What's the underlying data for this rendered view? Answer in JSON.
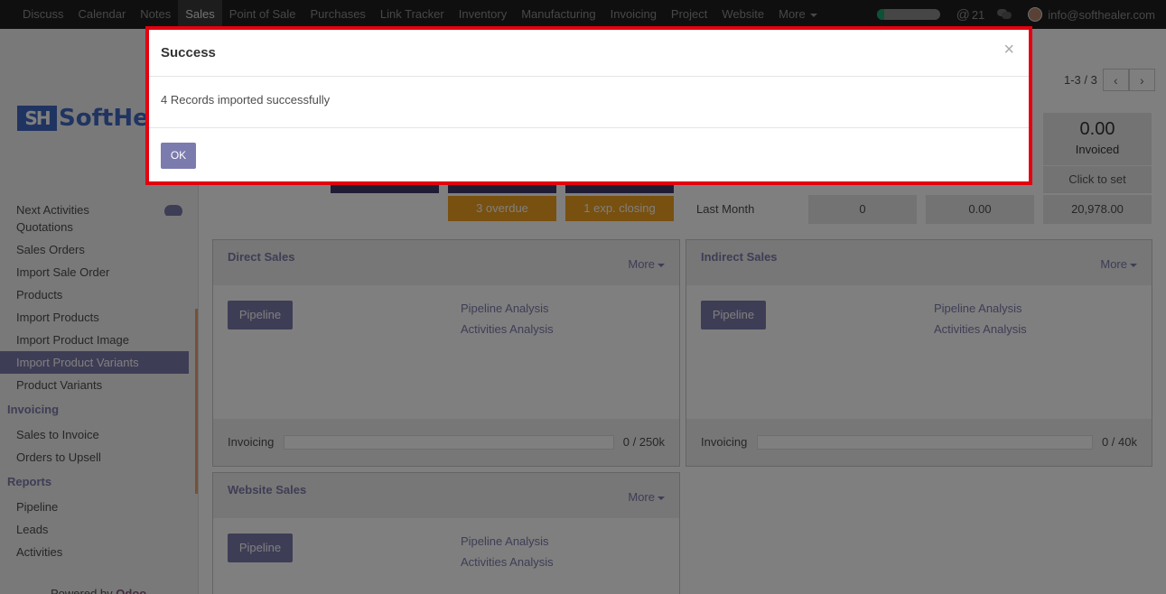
{
  "topbar": {
    "menu": [
      "Discuss",
      "Calendar",
      "Notes",
      "Sales",
      "Point of Sale",
      "Purchases",
      "Link Tracker",
      "Inventory",
      "Manufacturing",
      "Invoicing",
      "Project",
      "Website",
      "More"
    ],
    "active_index": 3,
    "notification_count": "21",
    "user_email": "info@softhealer.com",
    "progress_fraction": 0.12
  },
  "brand": {
    "logo_mark": "SH",
    "logo_word": "SoftHea"
  },
  "sidebar": {
    "top_partial": "Next Activities",
    "items_a": [
      "Quotations",
      "Sales Orders",
      "Import Sale Order",
      "Products",
      "Import Products",
      "Import Product Image",
      "Import Product Variants",
      "Product Variants"
    ],
    "selected": "Import Product Variants",
    "invoicing_header": "Invoicing",
    "invoicing_items": [
      "Sales to Invoice",
      "Orders to Upsell"
    ],
    "reports_header": "Reports",
    "reports_items": [
      "Pipeline",
      "Leads",
      "Activities"
    ],
    "powered_by": "Powered by",
    "powered_brand": "Odoo"
  },
  "pager": {
    "count": "1-3 / 3"
  },
  "stats": {
    "overdue_label": "3 overdue",
    "closing_label": "1 exp. closing",
    "last_month_label": "Last Month",
    "last_month_values": [
      "0",
      "0.00",
      "20,978.00"
    ],
    "invoiced_value": "0.00",
    "invoiced_label": "Invoiced",
    "click_to_set": "Click to set"
  },
  "cards": [
    {
      "title": "Direct Sales",
      "more": "More",
      "button": "Pipeline",
      "link1": "Pipeline Analysis",
      "link2": "Activities Analysis",
      "invoicing_label": "Invoicing",
      "invoicing_value": "0 / 250k"
    },
    {
      "title": "Indirect Sales",
      "more": "More",
      "button": "Pipeline",
      "link1": "Pipeline Analysis",
      "link2": "Activities Analysis",
      "invoicing_label": "Invoicing",
      "invoicing_value": "0 / 40k"
    },
    {
      "title": "Website Sales",
      "more": "More",
      "button": "Pipeline",
      "link1": "Pipeline Analysis",
      "link2": "Activities Analysis"
    }
  ],
  "modal": {
    "title": "Success",
    "close_glyph": "×",
    "message": "4 Records imported successfully",
    "ok_label": "OK"
  },
  "colors": {
    "accent": "#7c7bad",
    "orange": "#f0a01e",
    "modal_border": "#e3000f",
    "navbar": "#1f1f1f"
  }
}
